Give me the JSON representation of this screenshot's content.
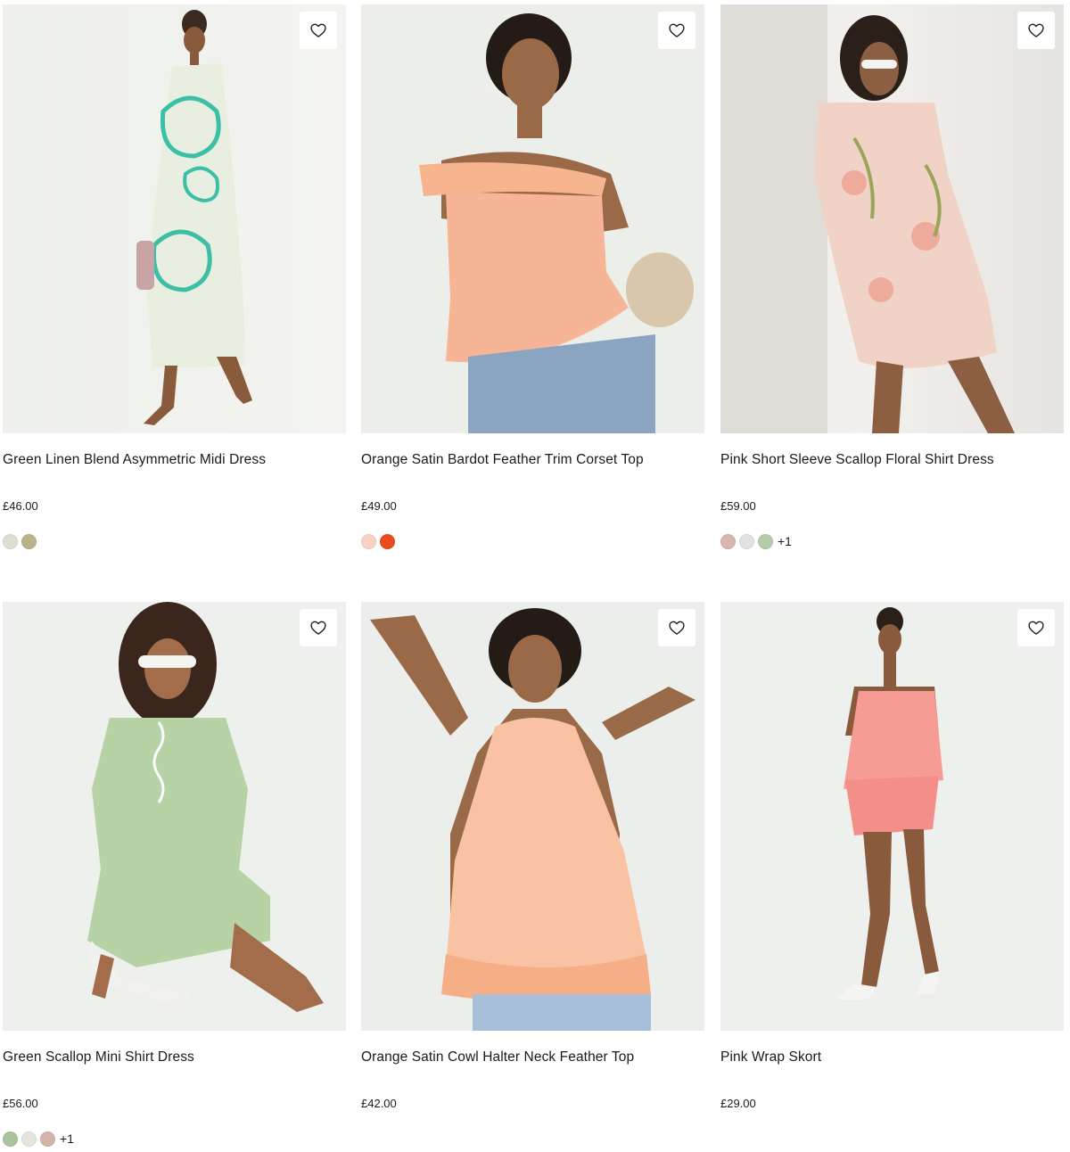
{
  "colors": {
    "wish_icon": "#1a1a1a"
  },
  "products": [
    {
      "name": "Green Linen Blend Asymmetric Midi Dress",
      "price": "£46.00",
      "wishlist_icon": "heart-outline-icon",
      "swatches": [
        "#dcdfd2",
        "#b7b48c"
      ],
      "more": ""
    },
    {
      "name": "Orange Satin Bardot Feather Trim Corset Top",
      "price": "£49.00",
      "wishlist_icon": "heart-outline-icon",
      "swatches": [
        "#f8d3c4",
        "#ec4b1d"
      ],
      "more": ""
    },
    {
      "name": "Pink Short Sleeve Scallop Floral Shirt Dress",
      "price": "£59.00",
      "wishlist_icon": "heart-outline-icon",
      "swatches": [
        "#d6b6ad",
        "#e2e3de",
        "#b3ccaa"
      ],
      "more": "+1"
    },
    {
      "name": "Green Scallop Mini Shirt Dress",
      "price": "£56.00",
      "wishlist_icon": "heart-outline-icon",
      "swatches": [
        "#a9c49f",
        "#e4e5dc",
        "#d2b4a9"
      ],
      "more": "+1"
    },
    {
      "name": "Orange Satin Cowl Halter Neck Feather Top",
      "price": "£42.00",
      "wishlist_icon": "heart-outline-icon",
      "swatches": [],
      "more": ""
    },
    {
      "name": "Pink Wrap Skort",
      "price": "£29.00",
      "wishlist_icon": "heart-outline-icon",
      "swatches": [],
      "more": ""
    }
  ]
}
